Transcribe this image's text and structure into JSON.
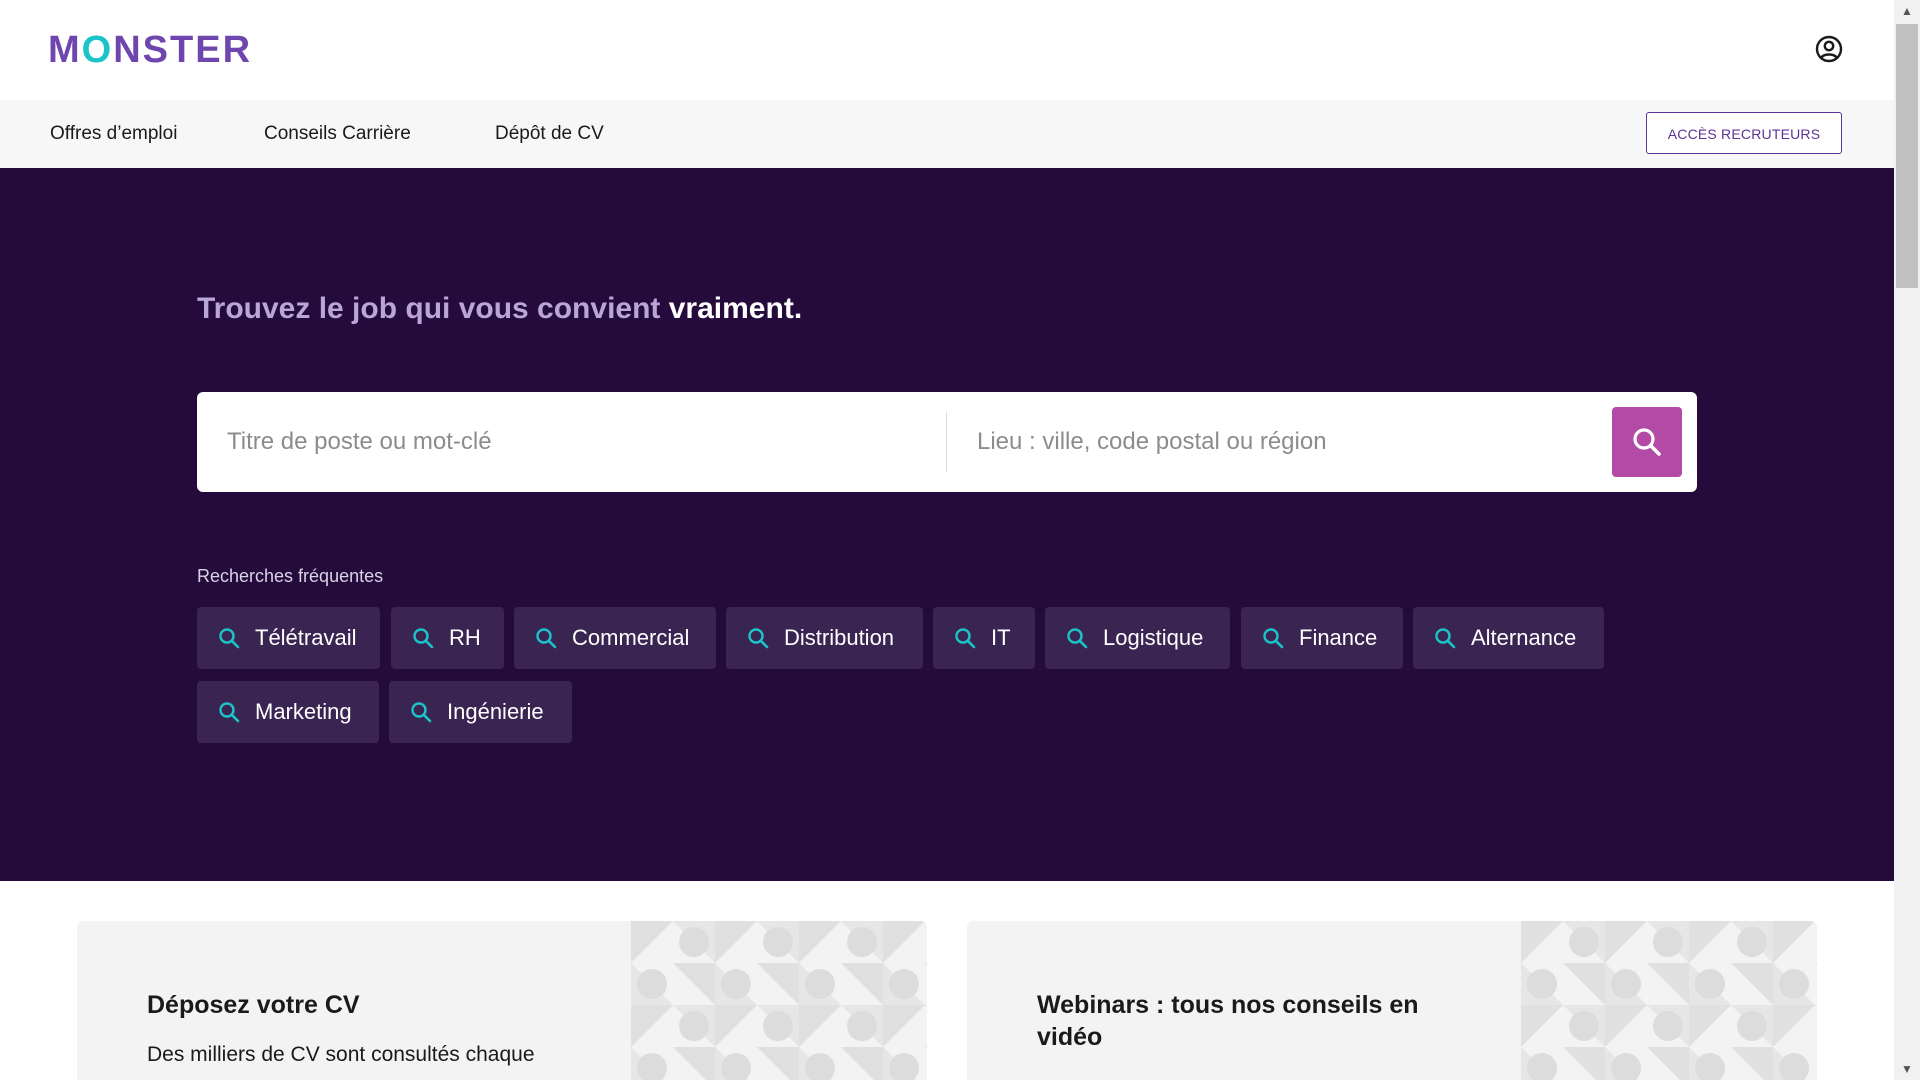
{
  "brand": {
    "logo_text_pre": "M",
    "logo_text_o": "O",
    "logo_text_post": "NSTER",
    "primary_color": "#6e46ae",
    "accent_color": "#1ac4c9"
  },
  "header": {
    "account_icon": "user-circle-icon"
  },
  "nav": {
    "links": [
      "Offres d’emploi",
      "Conseils Carrière",
      "Dépôt de CV"
    ],
    "recruiter_button": "ACCÈS RECRUTEURS"
  },
  "hero": {
    "title_part1": "Trouvez le job qui vous convient ",
    "title_part2": "vraiment",
    "title_part3": ".",
    "keyword_placeholder": "Titre de poste ou mot-clé",
    "location_placeholder": "Lieu : ville, code postal ou région",
    "search_button_icon": "search-icon",
    "frequent_label": "Recherches fréquentes",
    "chips": [
      "Télétravail",
      "RH",
      "Commercial",
      "Distribution",
      "IT",
      "Logistique",
      "Finance",
      "Alternance",
      "Marketing",
      "Ingénierie"
    ],
    "background_color": "#250a3c",
    "search_button_color": "#b24aa6"
  },
  "cards": [
    {
      "title": "Déposez votre CV",
      "text": "Des milliers de CV sont consultés chaque"
    },
    {
      "title": "Webinars : tous nos conseils en vidéo",
      "text": ""
    }
  ]
}
